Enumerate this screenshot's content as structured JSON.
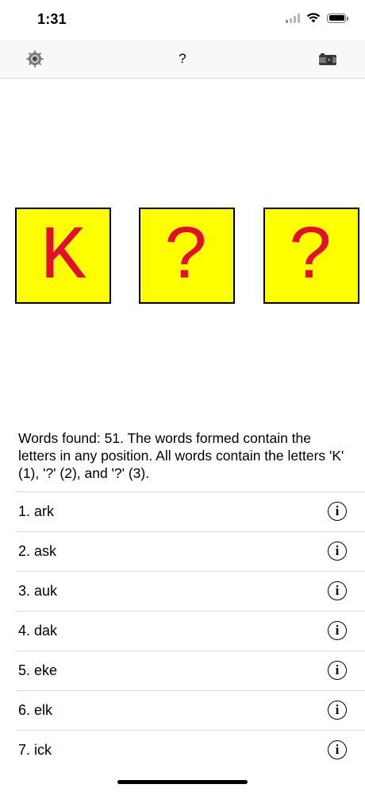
{
  "status_bar": {
    "time": "1:31"
  },
  "nav": {
    "title": "?",
    "left_icon": "gear-icon",
    "right_icon": "camera-icon"
  },
  "tiles": [
    {
      "letter": "K",
      "color": "#ffff00",
      "text_color": "#e0102a"
    },
    {
      "letter": "?",
      "color": "#ffff00",
      "text_color": "#e0102a"
    },
    {
      "letter": "?",
      "color": "#ffff00",
      "text_color": "#e0102a"
    }
  ],
  "summary": "Words found: 51.  The words formed contain the letters in any position.  All words contain the letters 'K' (1), '?' (2), and '?' (3).",
  "words": [
    {
      "label": "1. ark"
    },
    {
      "label": "2. ask"
    },
    {
      "label": "3. auk"
    },
    {
      "label": "4. dak"
    },
    {
      "label": "5. eke"
    },
    {
      "label": "6. elk"
    },
    {
      "label": "7. ick"
    }
  ],
  "info_glyph": "i"
}
